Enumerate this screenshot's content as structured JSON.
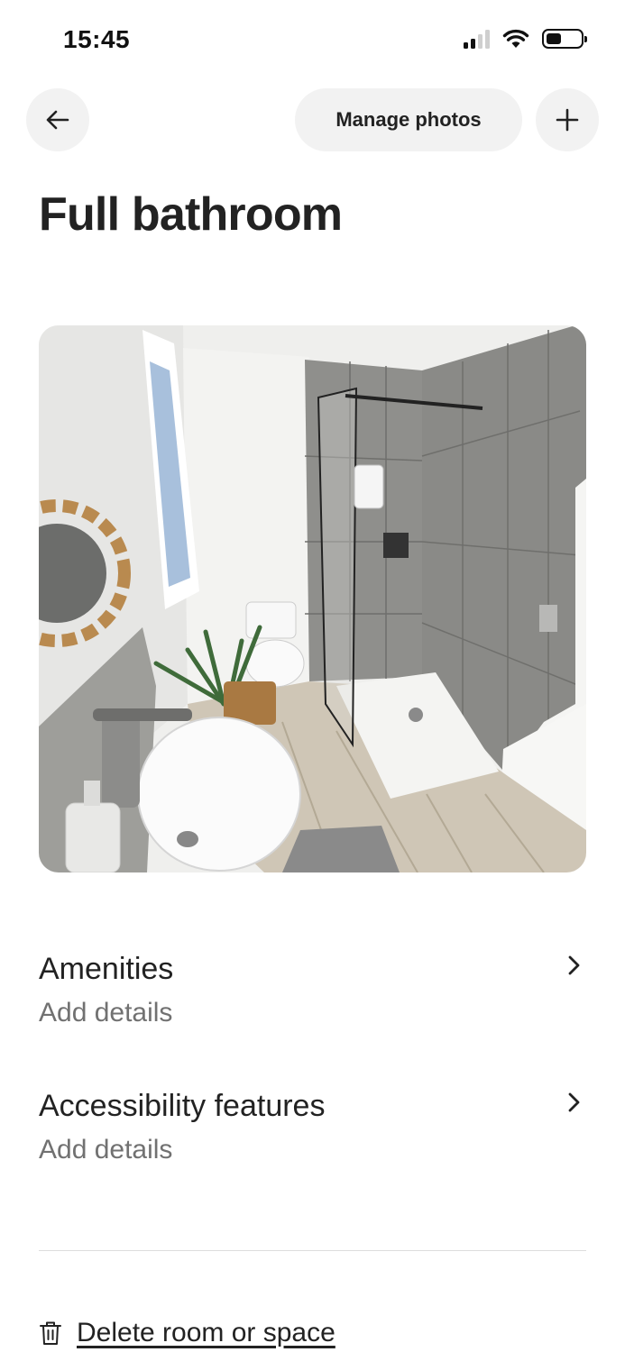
{
  "status_bar": {
    "time": "15:45",
    "signal_bars_active": 2,
    "signal_bars_total": 4,
    "battery_level": 0.45
  },
  "header": {
    "manage_photos_label": "Manage photos",
    "back_icon": "arrow-left-icon",
    "add_icon": "plus-icon"
  },
  "page": {
    "title": "Full bathroom"
  },
  "sections": [
    {
      "title": "Amenities",
      "subtitle": "Add details"
    },
    {
      "title": "Accessibility features",
      "subtitle": "Add details"
    }
  ],
  "footer": {
    "delete_label": "Delete room or space",
    "delete_icon": "trash-icon"
  }
}
